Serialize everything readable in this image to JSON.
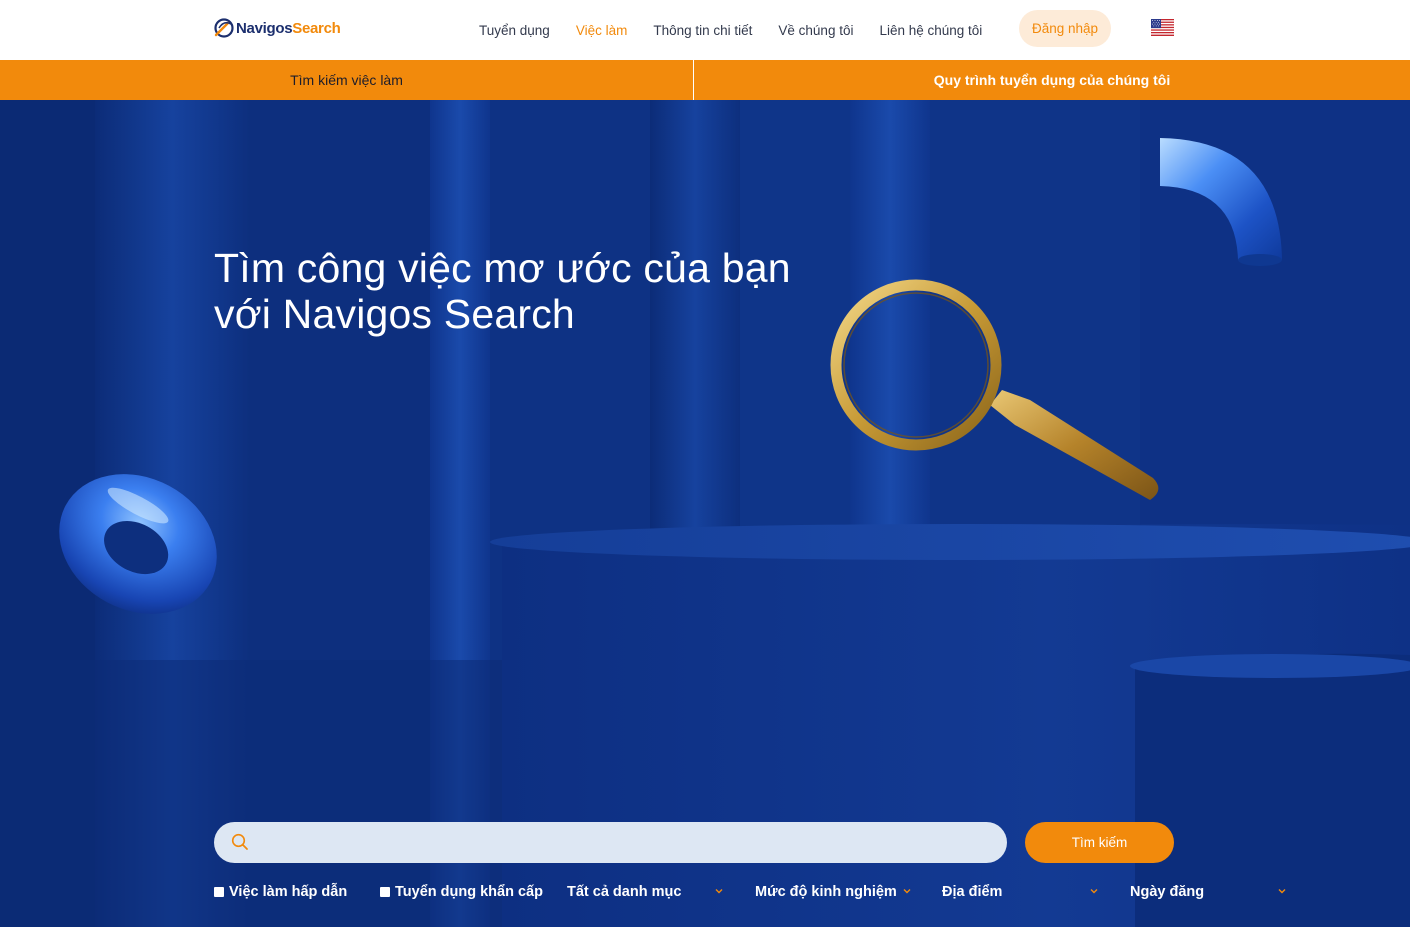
{
  "brand": {
    "logo_part1": "Navigos",
    "logo_part2": "Search",
    "accent": "#f28a0c",
    "navy": "#1c2f6e"
  },
  "nav": {
    "items": [
      {
        "label": "Tuyển dụng"
      },
      {
        "label": "Việc làm",
        "active": true
      },
      {
        "label": "Thông tin chi tiết"
      },
      {
        "label": "Về chúng tôi"
      },
      {
        "label": "Liên hệ chúng tôi"
      }
    ],
    "login_label": "Đăng nhập",
    "language_icon": "us-flag-icon"
  },
  "subnav": {
    "job_search_label": "Tìm kiếm việc làm",
    "process_label": "Quy trình tuyển dụng của chúng tôi"
  },
  "hero": {
    "title_line1": "Tìm công việc mơ ước của bạn",
    "title_line2": "với Navigos Search"
  },
  "search": {
    "placeholder": "",
    "value": "",
    "button_label": "Tìm kiếm",
    "icon": "search-icon"
  },
  "filters": {
    "hot_jobs_label": "Việc làm hấp dẫn",
    "urgent_label": "Tuyển dụng khẩn cấp",
    "category_label": "Tất cả danh mục",
    "experience_label": "Mức độ kinh nghiệm",
    "location_label": "Địa điểm",
    "date_label": "Ngày đăng"
  }
}
